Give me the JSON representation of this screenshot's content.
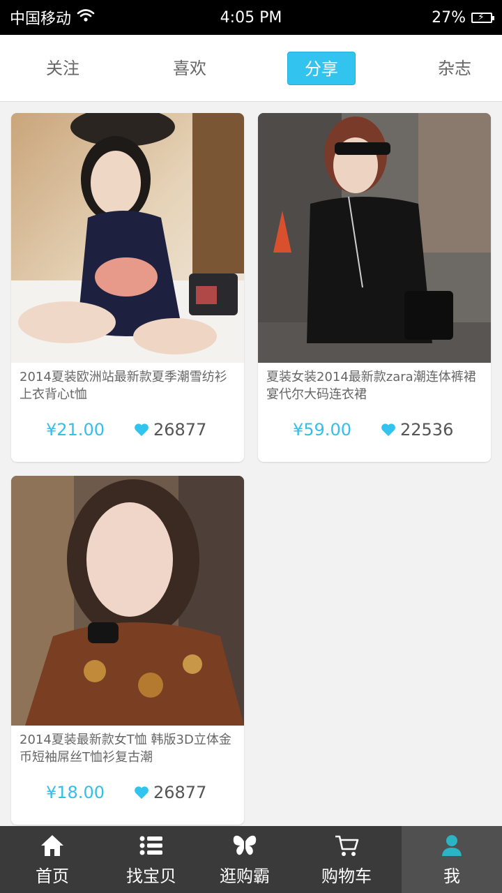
{
  "status_bar": {
    "carrier": "中国移动",
    "time": "4:05 PM",
    "battery": "27%"
  },
  "tabs": [
    {
      "label": "关注",
      "active": false
    },
    {
      "label": "喜欢",
      "active": false
    },
    {
      "label": "分享",
      "active": true
    },
    {
      "label": "杂志",
      "active": false
    }
  ],
  "products": [
    {
      "title": "2014夏装欧洲站最新款夏季潮雪纺衫上衣背心t恤",
      "price": "¥21.00",
      "likes": "26877"
    },
    {
      "title": "夏装女装2014最新款zara潮连体裤裙宴代尔大码连衣裙",
      "price": "¥59.00",
      "likes": "22536"
    },
    {
      "title": "2014夏装最新款女T恤 韩版3D立体金币短袖屌丝T恤衫复古潮",
      "price": "¥18.00",
      "likes": "26877"
    }
  ],
  "bottom_nav": [
    {
      "label": "首页",
      "icon": "home-icon"
    },
    {
      "label": "找宝贝",
      "icon": "list-icon"
    },
    {
      "label": "逛购霸",
      "icon": "butterfly-icon"
    },
    {
      "label": "购物车",
      "icon": "cart-icon"
    },
    {
      "label": "我",
      "icon": "user-icon",
      "active": true
    }
  ],
  "colors": {
    "accent": "#33c3ef",
    "nav_bg": "#3a3a3a",
    "nav_active_bg": "#505050",
    "page_bg": "#f2f2f2"
  }
}
